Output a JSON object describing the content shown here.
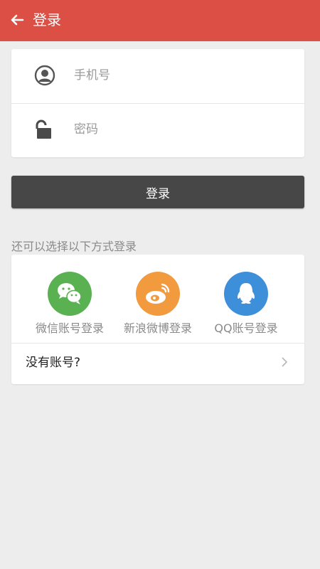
{
  "header": {
    "title": "登录",
    "background": "#db4f45",
    "back_icon": "arrow-left-icon"
  },
  "form": {
    "phone": {
      "placeholder": "手机号",
      "value": "",
      "icon": "user-circle-icon"
    },
    "password": {
      "placeholder": "密码",
      "value": "",
      "icon": "unlock-icon"
    }
  },
  "login_button": {
    "label": "登录",
    "color": "#474747"
  },
  "alt_login": {
    "label": "还可以选择以下方式登录",
    "options": [
      {
        "label": "微信账号登录",
        "icon": "wechat-icon",
        "color": "#5ab152"
      },
      {
        "label": "新浪微博登录",
        "icon": "weibo-icon",
        "color": "#f19a3e"
      },
      {
        "label": "QQ账号登录",
        "icon": "qq-icon",
        "color": "#3e8fd9"
      }
    ]
  },
  "signup": {
    "label": "没有账号?",
    "icon": "chevron-right-icon"
  }
}
